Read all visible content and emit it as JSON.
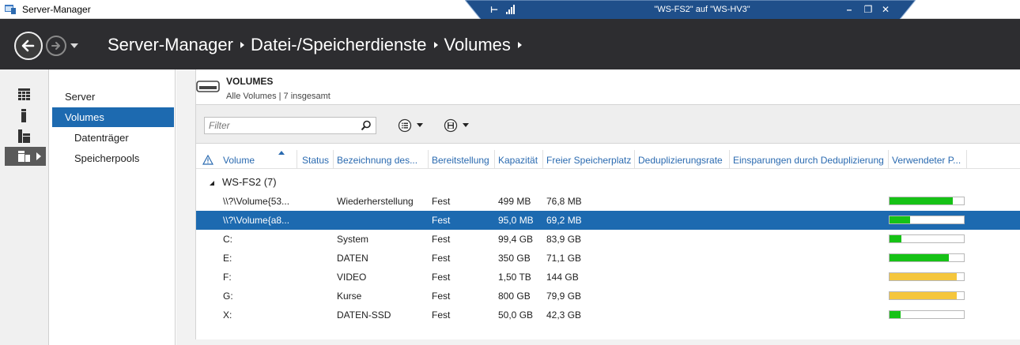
{
  "window": {
    "title": "Server-Manager"
  },
  "rdp": {
    "title": "\"WS-FS2\" auf \"WS-HV3\"",
    "pin_glyph": "⊢",
    "minimize_glyph": "–",
    "restore_glyph": "❐",
    "close_glyph": "✕"
  },
  "breadcrumb": [
    "Server-Manager",
    "Datei-/Speicherdienste",
    "Volumes"
  ],
  "nav": {
    "items": [
      {
        "label": "Server",
        "active": false,
        "sub": false
      },
      {
        "label": "Volumes",
        "active": true,
        "sub": false
      },
      {
        "label": "Datenträger",
        "active": false,
        "sub": true
      },
      {
        "label": "Speicherpools",
        "active": false,
        "sub": true
      }
    ]
  },
  "rail": {
    "icons": [
      "dashboard-icon",
      "local-server-icon",
      "all-servers-icon",
      "file-storage-icon"
    ]
  },
  "tile": {
    "title": "VOLUMES",
    "subtitle": "Alle Volumes | 7 insgesamt",
    "filter_placeholder": "Filter"
  },
  "grid": {
    "columns": [
      "Volume",
      "Status",
      "Bezeichnung des...",
      "Bereitstellung",
      "Kapazität",
      "Freier Speicherplatz",
      "Deduplizierungsrate",
      "Einsparungen durch Deduplizierung",
      "Verwendeter P..."
    ],
    "group": {
      "label": "WS-FS2 (7)"
    },
    "rows": [
      {
        "volume": "\\\\?\\Volume{53...",
        "status": "",
        "label": "Wiederherstellung",
        "provisioning": "Fest",
        "capacity": "499 MB",
        "free": "76,8 MB",
        "dedup_rate": "",
        "dedup_savings": "",
        "used_fraction": 0.85,
        "bar_color": "#16c216",
        "selected": false
      },
      {
        "volume": "\\\\?\\Volume{a8...",
        "status": "",
        "label": "",
        "provisioning": "Fest",
        "capacity": "95,0 MB",
        "free": "69,2 MB",
        "dedup_rate": "",
        "dedup_savings": "",
        "used_fraction": 0.28,
        "bar_color": "#16c216",
        "selected": true
      },
      {
        "volume": "C:",
        "status": "",
        "label": "System",
        "provisioning": "Fest",
        "capacity": "99,4 GB",
        "free": "83,9 GB",
        "dedup_rate": "",
        "dedup_savings": "",
        "used_fraction": 0.16,
        "bar_color": "#16c216",
        "selected": false
      },
      {
        "volume": "E:",
        "status": "",
        "label": "DATEN",
        "provisioning": "Fest",
        "capacity": "350 GB",
        "free": "71,1 GB",
        "dedup_rate": "",
        "dedup_savings": "",
        "used_fraction": 0.8,
        "bar_color": "#16c216",
        "selected": false
      },
      {
        "volume": "F:",
        "status": "",
        "label": "VIDEO",
        "provisioning": "Fest",
        "capacity": "1,50 TB",
        "free": "144 GB",
        "dedup_rate": "",
        "dedup_savings": "",
        "used_fraction": 0.9,
        "bar_color": "#f5c63c",
        "selected": false
      },
      {
        "volume": "G:",
        "status": "",
        "label": "Kurse",
        "provisioning": "Fest",
        "capacity": "800 GB",
        "free": "79,9 GB",
        "dedup_rate": "",
        "dedup_savings": "",
        "used_fraction": 0.9,
        "bar_color": "#f5c63c",
        "selected": false
      },
      {
        "volume": "X:",
        "status": "",
        "label": "DATEN-SSD",
        "provisioning": "Fest",
        "capacity": "50,0 GB",
        "free": "42,3 GB",
        "dedup_rate": "",
        "dedup_savings": "",
        "used_fraction": 0.15,
        "bar_color": "#16c216",
        "selected": false
      }
    ]
  },
  "colors": {
    "accent": "#1d6ab0",
    "header_bg": "#2d2d30",
    "rdp_bar": "#1f4f8a",
    "link_text": "#2a6ab0"
  }
}
